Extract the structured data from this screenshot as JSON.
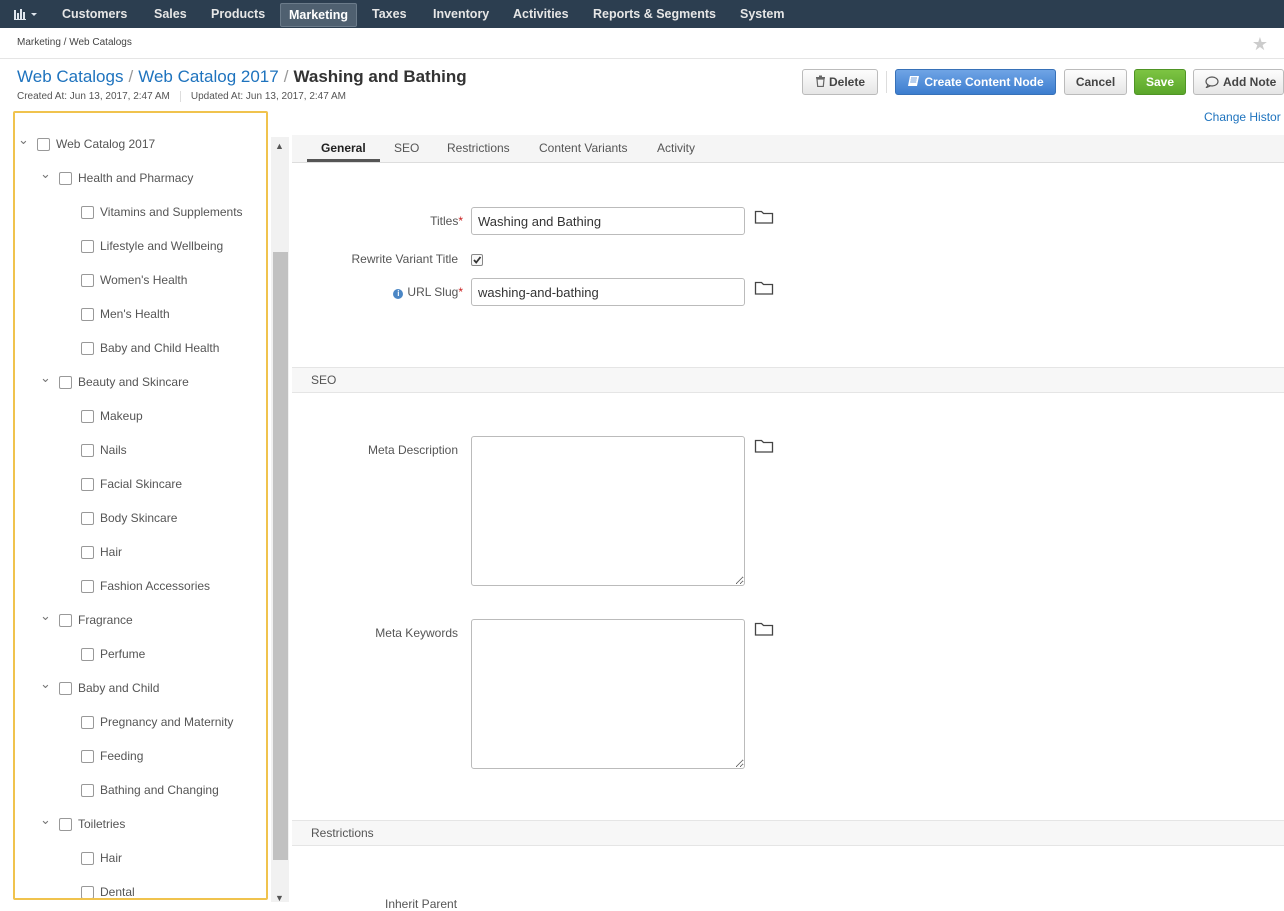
{
  "nav": {
    "items": [
      "Customers",
      "Sales",
      "Products",
      "Marketing",
      "Taxes",
      "Inventory",
      "Activities",
      "Reports & Segments",
      "System"
    ],
    "active": "Marketing"
  },
  "breadcrumb": "Marketing / Web Catalogs",
  "title": {
    "parent1": "Web Catalogs",
    "parent2": "Web Catalog 2017",
    "current": "Washing and Bathing"
  },
  "meta": {
    "created": "Created At: Jun 13, 2017, 2:47 AM",
    "updated": "Updated At: Jun 13, 2017, 2:47 AM"
  },
  "actions": {
    "delete": "Delete",
    "create_node": "Create Content Node",
    "cancel": "Cancel",
    "save": "Save",
    "add_note": "Add Note",
    "change_history": "Change Histor"
  },
  "tree": [
    {
      "label": "Web Catalog 2017",
      "level": 0,
      "expanded": true
    },
    {
      "label": "Health and Pharmacy",
      "level": 1,
      "expanded": true
    },
    {
      "label": "Vitamins and Supplements",
      "level": 2
    },
    {
      "label": "Lifestyle and Wellbeing",
      "level": 2
    },
    {
      "label": "Women's Health",
      "level": 2
    },
    {
      "label": "Men's Health",
      "level": 2
    },
    {
      "label": "Baby and Child Health",
      "level": 2
    },
    {
      "label": "Beauty and Skincare",
      "level": 1,
      "expanded": true
    },
    {
      "label": "Makeup",
      "level": 2
    },
    {
      "label": "Nails",
      "level": 2
    },
    {
      "label": "Facial Skincare",
      "level": 2
    },
    {
      "label": "Body Skincare",
      "level": 2
    },
    {
      "label": "Hair",
      "level": 2
    },
    {
      "label": "Fashion Accessories",
      "level": 2
    },
    {
      "label": "Fragrance",
      "level": 1,
      "expanded": true
    },
    {
      "label": "Perfume",
      "level": 2
    },
    {
      "label": "Baby and Child",
      "level": 1,
      "expanded": true
    },
    {
      "label": "Pregnancy and Maternity",
      "level": 2
    },
    {
      "label": "Feeding",
      "level": 2
    },
    {
      "label": "Bathing and Changing",
      "level": 2
    },
    {
      "label": "Toiletries",
      "level": 1,
      "expanded": true
    },
    {
      "label": "Hair",
      "level": 2
    },
    {
      "label": "Dental",
      "level": 2
    }
  ],
  "tabs": [
    "General",
    "SEO",
    "Restrictions",
    "Content Variants",
    "Activity"
  ],
  "active_tab": "General",
  "form": {
    "titles_label": "Titles",
    "titles_value": "Washing and Bathing",
    "rewrite_label": "Rewrite Variant Title",
    "rewrite_checked": true,
    "slug_label": "URL Slug",
    "slug_value": "washing-and-bathing",
    "required_mark": "*",
    "info_glyph": "i",
    "seo_section": "SEO",
    "meta_desc_label": "Meta Description",
    "meta_keywords_label": "Meta Keywords",
    "restrictions_section": "Restrictions",
    "inherit_parent_label": "Inherit Parent"
  }
}
